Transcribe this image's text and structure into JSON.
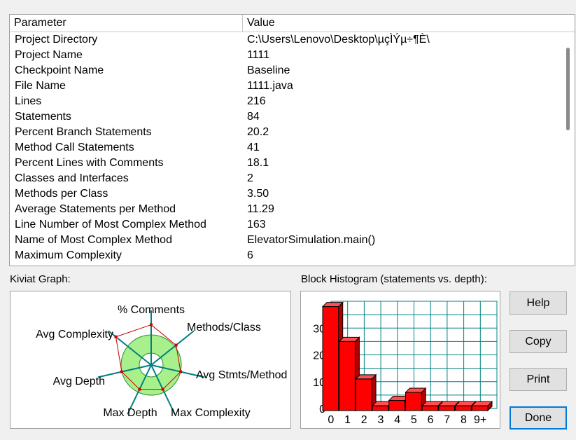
{
  "table": {
    "headers": {
      "parameter": "Parameter",
      "value": "Value"
    },
    "rows": [
      {
        "parameter": "Project Directory",
        "value": "C:\\Users\\Lenovo\\Desktop\\µçÌÝµ÷¶È\\"
      },
      {
        "parameter": "Project Name",
        "value": "1111"
      },
      {
        "parameter": "Checkpoint Name",
        "value": "Baseline"
      },
      {
        "parameter": "File Name",
        "value": "1111.java"
      },
      {
        "parameter": "Lines",
        "value": "216"
      },
      {
        "parameter": "Statements",
        "value": "84"
      },
      {
        "parameter": "Percent Branch Statements",
        "value": "20.2"
      },
      {
        "parameter": "Method Call Statements",
        "value": "41"
      },
      {
        "parameter": "Percent Lines with Comments",
        "value": "18.1"
      },
      {
        "parameter": "Classes and Interfaces",
        "value": "2"
      },
      {
        "parameter": "Methods per Class",
        "value": "3.50"
      },
      {
        "parameter": "Average Statements per Method",
        "value": "11.29"
      },
      {
        "parameter": "Line Number of Most Complex Method",
        "value": "163"
      },
      {
        "parameter": "Name of Most Complex Method",
        "value": "ElevatorSimulation.main()"
      },
      {
        "parameter": "Maximum Complexity",
        "value": "6"
      }
    ]
  },
  "kiviat": {
    "label": "Kiviat Graph:",
    "axes": [
      "% Comments",
      "Methods/Class",
      "Avg Stmts/Method",
      "Max Complexity",
      "Max Depth",
      "Avg Depth",
      "Avg Complexity"
    ],
    "colors": {
      "band_fill": "#a8f08c",
      "band_stroke": "#2a8a2a",
      "axis": "#008080",
      "profile": "#cc0000"
    }
  },
  "histogram": {
    "label": "Block Histogram (statements vs. depth):",
    "colors": {
      "bar": "#ff0000",
      "grid": "#008080",
      "outline": "#000000"
    }
  },
  "chart_data": {
    "type": "bar",
    "title": "Block Histogram (statements vs. depth):",
    "xlabel": "",
    "ylabel": "",
    "categories": [
      "0",
      "1",
      "2",
      "3",
      "4",
      "5",
      "6",
      "7",
      "8",
      "9+"
    ],
    "values": [
      38,
      25,
      11,
      1,
      3,
      6,
      1,
      1,
      1,
      1
    ],
    "ylim": [
      0,
      40
    ],
    "yticks": [
      0,
      10,
      20,
      30
    ],
    "grid": true
  },
  "buttons": {
    "help": "Help",
    "copy": "Copy",
    "print": "Print",
    "done": "Done"
  }
}
